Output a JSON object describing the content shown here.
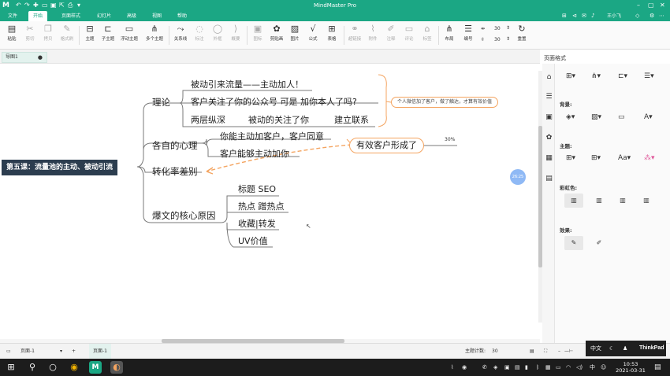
{
  "app": {
    "title": "MindMaster Pro",
    "logo": "M",
    "quick_access_icons": [
      "undo-icon",
      "redo-icon",
      "new-icon",
      "open-icon",
      "save-icon",
      "export-icon"
    ],
    "user_label": "王小飞"
  },
  "menus": [
    "文件",
    "开始",
    "页面样式",
    "幻灯片",
    "高级",
    "视图",
    "帮助"
  ],
  "active_menu": "开始",
  "ribbon": {
    "buttons": [
      {
        "label": "粘贴",
        "icon": "clipboard-icon",
        "enabled": true
      },
      {
        "label": "剪切",
        "icon": "scissors-icon",
        "enabled": false
      },
      {
        "label": "拷贝",
        "icon": "copy-icon",
        "enabled": false
      },
      {
        "label": "格式刷",
        "icon": "format-painter-icon",
        "enabled": false
      },
      {
        "label": "主题",
        "icon": "topic-icon",
        "enabled": true
      },
      {
        "label": "子主题",
        "icon": "subtopic-icon",
        "enabled": true
      },
      {
        "label": "浮动主题",
        "icon": "floating-topic-icon",
        "enabled": true
      },
      {
        "label": "多个主题",
        "icon": "multiple-topics-icon",
        "enabled": true
      },
      {
        "label": "关系线",
        "icon": "relationship-icon",
        "enabled": true
      },
      {
        "label": "标注",
        "icon": "callout-icon",
        "enabled": false
      },
      {
        "label": "外框",
        "icon": "boundary-icon",
        "enabled": false
      },
      {
        "label": "概要",
        "icon": "summary-icon",
        "enabled": false
      },
      {
        "label": "图标",
        "icon": "mark-icon",
        "enabled": false
      },
      {
        "label": "剪贴画",
        "icon": "clipart-icon",
        "enabled": true
      },
      {
        "label": "图片",
        "icon": "image-icon",
        "enabled": true
      },
      {
        "label": "公式",
        "icon": "formula-icon",
        "enabled": true
      },
      {
        "label": "表格",
        "icon": "table-icon",
        "enabled": true
      },
      {
        "label": "超链接",
        "icon": "hyperlink-icon",
        "enabled": false
      },
      {
        "label": "附件",
        "icon": "attachment-icon",
        "enabled": false
      },
      {
        "label": "注释",
        "icon": "note-icon",
        "enabled": false
      },
      {
        "label": "评论",
        "icon": "comment-icon",
        "enabled": false
      },
      {
        "label": "标签",
        "icon": "tag-icon",
        "enabled": false
      },
      {
        "label": "布局",
        "icon": "layout-icon",
        "enabled": true
      },
      {
        "label": "编号",
        "icon": "numbering-icon",
        "enabled": true
      },
      {
        "label": "重置",
        "icon": "reset-icon",
        "enabled": true
      }
    ],
    "spacing_h": "30",
    "spacing_v": "30"
  },
  "document_tab": "导图1",
  "mindmap": {
    "root": "第五课：流量池的主动、被动引流",
    "theory": {
      "label": "理论",
      "children": [
        "被动引来流量——主动加人！",
        "客户关注了你的公众号 可是 加你本人了吗?",
        "两层纵深",
        "被动的关注了你",
        "建立联系"
      ],
      "callout": "个人微信加了客户，做了触达，才算有效价值"
    },
    "psychology": {
      "label": "各自的心理",
      "children": [
        "你能主动加客户，客户同意",
        "客户能够主动加你"
      ],
      "result": "有效客户形成了",
      "result_pct": "30%"
    },
    "conversion": {
      "label": "转化率差别"
    },
    "viral": {
      "label": "爆文的核心原因",
      "children": [
        "标题 SEO",
        "热点 蹭热点",
        "收藏|转发",
        "UV价值"
      ]
    },
    "badge": "26:25"
  },
  "right_panel": {
    "title": "页面格式",
    "sections": {
      "background": "背景:",
      "theme": "主题:",
      "rainbow": "彩虹色:",
      "effect": "效果:"
    },
    "theme_font_label": "Aa"
  },
  "status": {
    "page_selector": "页面-1",
    "page_tab": "页面-1",
    "topic_count_label": "主题计数:",
    "topic_count": "30"
  },
  "tray_popup": {
    "lang": "中文",
    "brand": "ThinkPad"
  },
  "taskbar": {
    "time": "10:53",
    "date": "2021-03-31",
    "ime": "中"
  },
  "colors": {
    "accent": "#1ba784",
    "root_bg": "#2c3d4f",
    "orange": "#f4a460"
  }
}
